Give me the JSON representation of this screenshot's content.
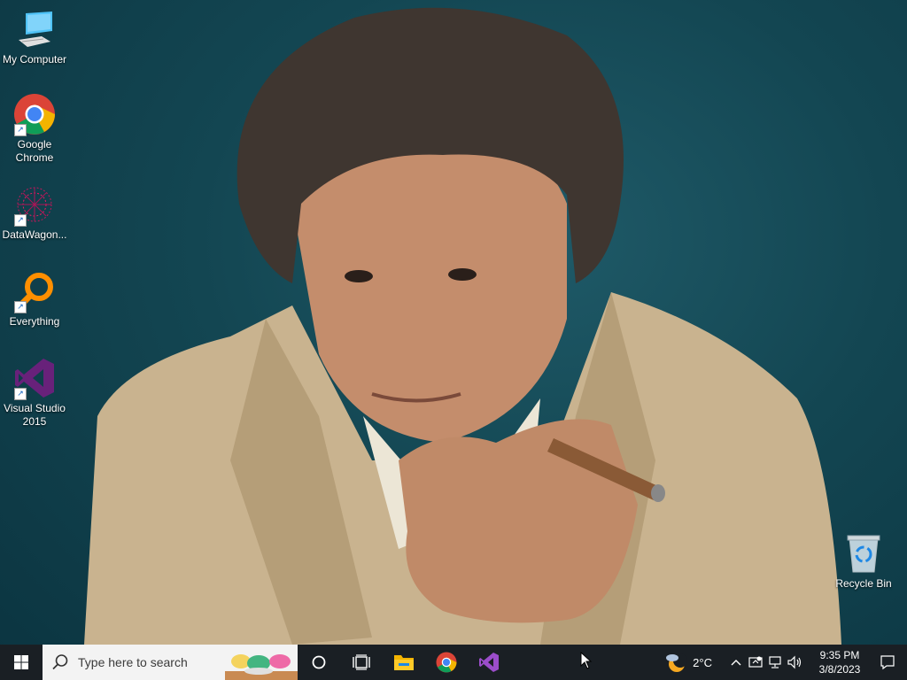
{
  "desktop_icons": [
    {
      "label": "My Computer",
      "icon": "computer-icon"
    },
    {
      "label": "Google\nChrome",
      "icon": "chrome-icon"
    },
    {
      "label": "DataWagon...",
      "icon": "datawagon-icon"
    },
    {
      "label": "Everything",
      "icon": "search-everything-icon"
    },
    {
      "label": "Visual Studio\n2015",
      "icon": "visual-studio-icon"
    },
    {
      "label": "Recycle Bin",
      "icon": "recycle-bin-icon"
    }
  ],
  "taskbar": {
    "search_placeholder": "Type here to search",
    "pinned": [
      "cortana-icon",
      "task-view-icon",
      "file-explorer-icon",
      "chrome-icon",
      "visual-studio-icon"
    ]
  },
  "tray": {
    "temperature": "2°C",
    "time": "9:35 PM",
    "date": "3/8/2023"
  },
  "colors": {
    "taskbar": "#1a1f24",
    "search_bg": "#f3f3f3",
    "wallpaper": "#134652"
  }
}
